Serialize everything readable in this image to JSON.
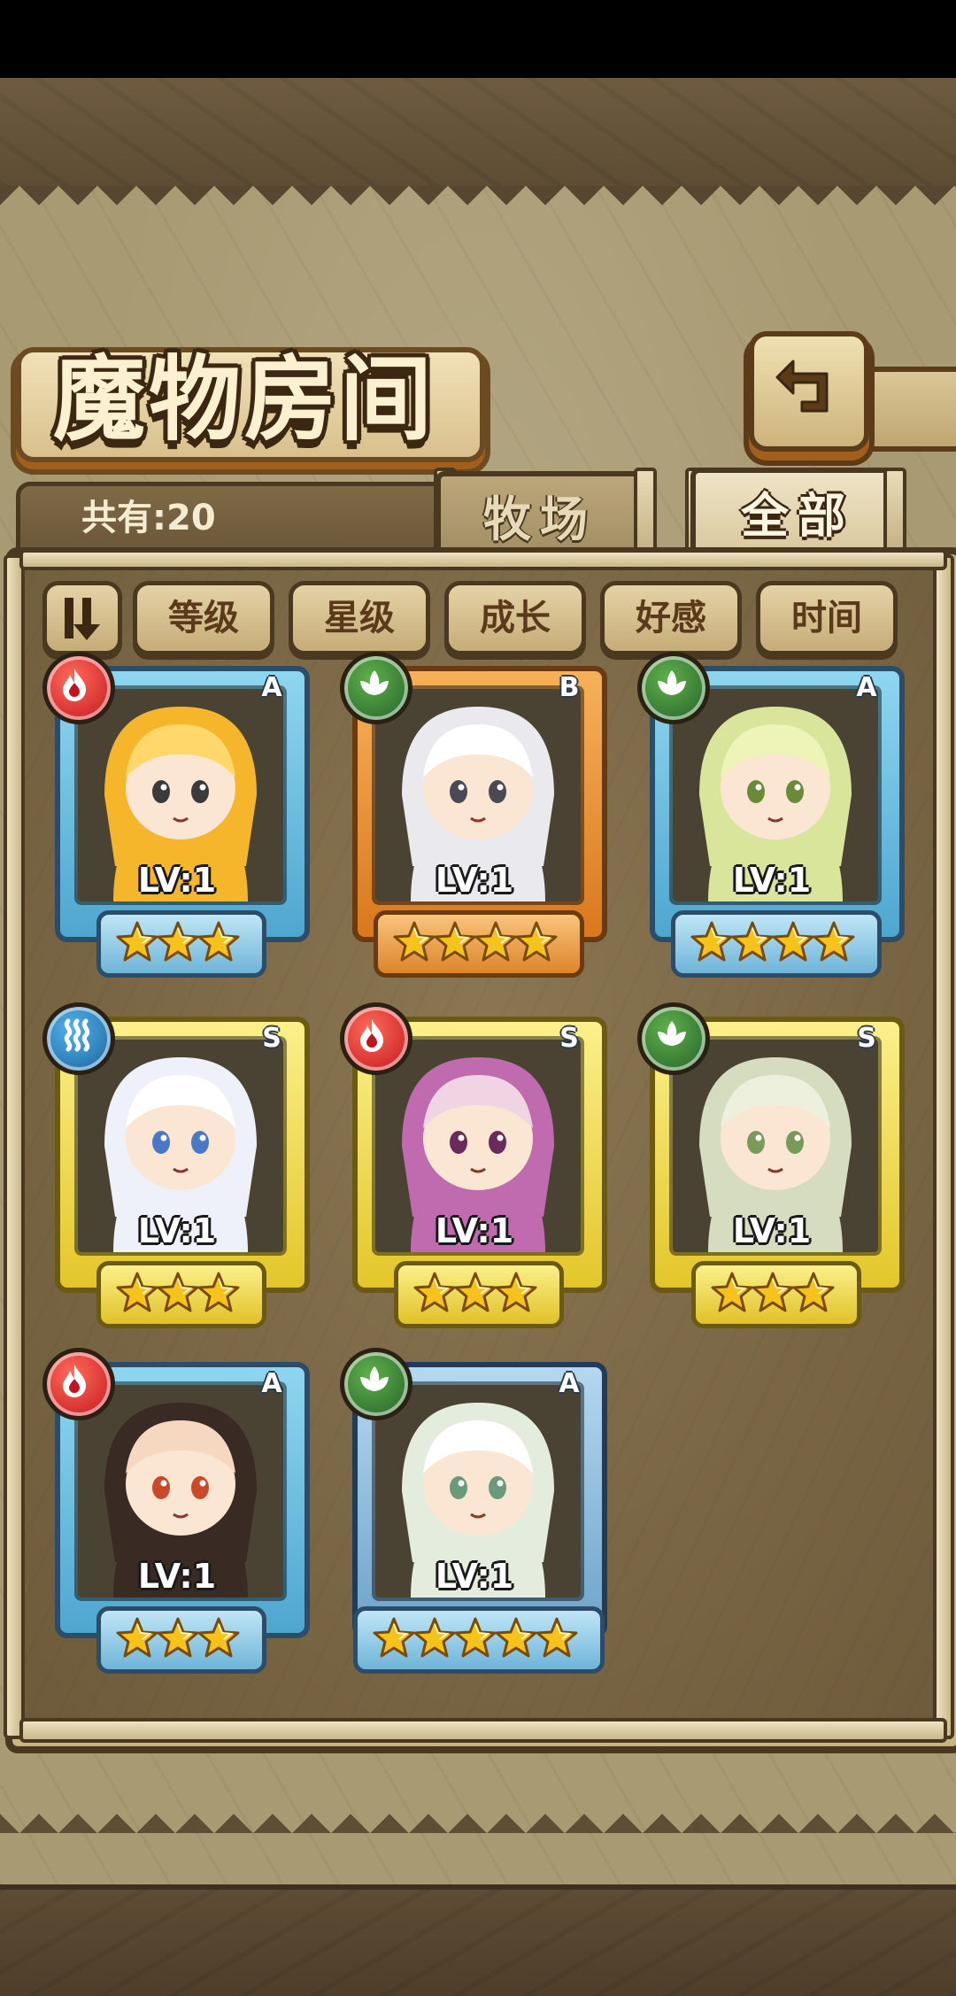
{
  "header": {
    "title": "魔物房间",
    "back_icon": "back-arrow-icon"
  },
  "tabs": {
    "count_label": "共有:20",
    "ranch_label": "牧场",
    "all_label": "全部",
    "active": "all"
  },
  "sort": {
    "toggle_icon": "sort-order-icon",
    "options": [
      "等级",
      "星级",
      "成长",
      "好感",
      "时间"
    ]
  },
  "colors": {
    "fire": "#c2141c",
    "leaf": "#23602a",
    "water": "#1a5e9a",
    "star": "#f6c21c"
  },
  "monsters": [
    {
      "element": "fire",
      "rank": "A",
      "level": "LV:1",
      "stars": 3
    },
    {
      "element": "leaf",
      "rank": "B",
      "level": "LV:1",
      "stars": 4
    },
    {
      "element": "leaf",
      "rank": "A",
      "level": "LV:1",
      "stars": 4
    },
    {
      "element": "water",
      "rank": "S",
      "level": "LV:1",
      "stars": 3
    },
    {
      "element": "fire",
      "rank": "S",
      "level": "LV:1",
      "stars": 3
    },
    {
      "element": "leaf",
      "rank": "S",
      "level": "LV:1",
      "stars": 3
    },
    {
      "element": "fire",
      "rank": "A",
      "level": "LV:1",
      "stars": 3
    },
    {
      "element": "leaf",
      "rank": "A",
      "level": "LV:1",
      "stars": 5
    }
  ]
}
